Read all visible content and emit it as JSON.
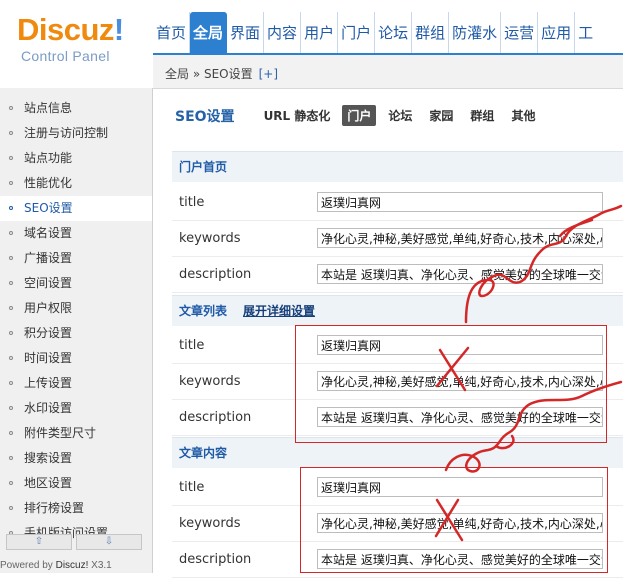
{
  "logo": {
    "brand": "Discuz",
    "bang": "!",
    "sub": "Control Panel"
  },
  "topnav": [
    "首页",
    "全局",
    "界面",
    "内容",
    "用户",
    "门户",
    "论坛",
    "群组",
    "防灌水",
    "运营",
    "应用",
    "工"
  ],
  "breadcrumb": {
    "path": "全局 » SEO设置",
    "plus": "[+]"
  },
  "sidebar": {
    "items": [
      "站点信息",
      "注册与访问控制",
      "站点功能",
      "性能优化",
      "SEO设置",
      "域名设置",
      "广播设置",
      "空间设置",
      "用户权限",
      "积分设置",
      "时间设置",
      "上传设置",
      "水印设置",
      "附件类型尺寸",
      "搜索设置",
      "地区设置",
      "排行榜设置",
      "手机版访问设置"
    ],
    "active_index": 4,
    "scroll_up": "⇧",
    "scroll_down": "⇩"
  },
  "powered": {
    "text": "Powered by ",
    "brand": "Discuz!",
    "version": " X3.1"
  },
  "main": {
    "title": "SEO设置",
    "tabs": [
      "URL 静态化",
      "门户",
      "论坛",
      "家园",
      "群组",
      "其他"
    ],
    "active_tab": 1,
    "sections": [
      {
        "title": "门户首页",
        "extra": "",
        "rows": [
          {
            "label": "title",
            "value": "返璞归真网"
          },
          {
            "label": "keywords",
            "value": "净化心灵,神秘,美好感觉,单纯,好奇心,技术,内心深处,心灵鸡汤"
          },
          {
            "label": "description",
            "value": "本站是 返璞归真、净化心灵、感觉美好的全球唯一交流平台"
          }
        ]
      },
      {
        "title": "文章列表",
        "extra": "展开详细设置",
        "rows": [
          {
            "label": "title",
            "value": "返璞归真网"
          },
          {
            "label": "keywords",
            "value": "净化心灵,神秘,美好感觉,单纯,好奇心,技术,内心深处,心灵鸡汤"
          },
          {
            "label": "description",
            "value": "本站是 返璞归真、净化心灵、感觉美好的全球唯一交流平台"
          }
        ]
      },
      {
        "title": "文章内容",
        "extra": "",
        "rows": [
          {
            "label": "title",
            "value": "返璞归真网"
          },
          {
            "label": "keywords",
            "value": "净化心灵,神秘,美好感觉,单纯,好奇心,技术,内心深处,心灵鸡汤"
          },
          {
            "label": "description",
            "value": "本站是 返璞归真、净化心灵、感觉美好的全球唯一交流平台"
          }
        ]
      }
    ]
  },
  "colors": {
    "accent": "#2d7fd0",
    "logo_orange": "#f08a0e",
    "annotation_red": "#d42828"
  }
}
